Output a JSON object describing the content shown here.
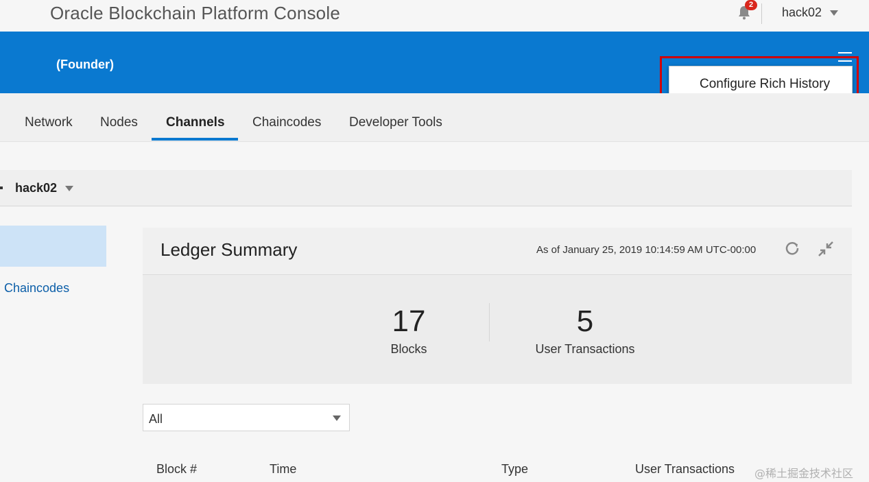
{
  "header": {
    "app_title": "Oracle Blockchain Platform Console",
    "notification_count": "2",
    "username": "hack02"
  },
  "banner": {
    "role": "(Founder)",
    "menu": {
      "item": "Configure Rich History"
    }
  },
  "tabs": [
    {
      "label": "Network",
      "active": false
    },
    {
      "label": "Nodes",
      "active": false
    },
    {
      "label": "Channels",
      "active": true
    },
    {
      "label": "Chaincodes",
      "active": false
    },
    {
      "label": "Developer Tools",
      "active": false
    }
  ],
  "channel": {
    "name": "hack02"
  },
  "sidebar": {
    "link": "Chaincodes"
  },
  "ledger": {
    "title": "Ledger Summary",
    "as_of": "As of January 25, 2019 10:14:59 AM UTC-00:00",
    "blocks": {
      "value": "17",
      "label": "Blocks"
    },
    "user_transactions": {
      "value": "5",
      "label": "User Transactions"
    }
  },
  "filter": {
    "value": "All"
  },
  "table": {
    "headers": [
      "Block #",
      "Time",
      "Type",
      "User Transactions"
    ]
  },
  "watermark": "@稀土掘金技术社区",
  "colors": {
    "brand_blue": "#0a79d0",
    "highlight_red": "#d10000",
    "badge_red": "#d9261c"
  }
}
